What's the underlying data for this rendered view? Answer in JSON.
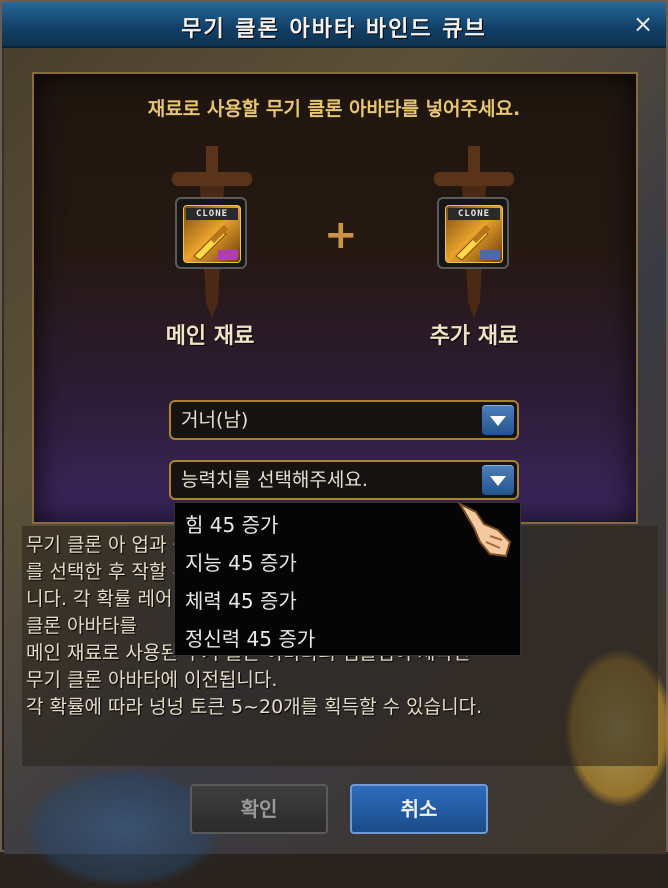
{
  "window": {
    "title": "무기 클론 아바타 바인드 큐브",
    "close_label": "×"
  },
  "instruction": "재료로 사용할 무기 클론 아바타를 넣어주세요.",
  "slots": {
    "main": {
      "caption": "메인 재료",
      "clone_tag": "CLONE"
    },
    "plus": "+",
    "extra": {
      "caption": "추가 재료",
      "clone_tag": "CLONE"
    }
  },
  "selects": {
    "job": {
      "value": "거너(남)"
    },
    "stat": {
      "value": "능력치를 선택해주세요."
    }
  },
  "dropdown": {
    "options": [
      "힘 45 증가",
      "지능 45 증가",
      "체력 45 증가",
      "정신력 45 증가"
    ]
  },
  "description": {
    "lines": [
      "무기 클론 아                                    업과 능력치",
      "를 선택한 후                                    작할 수 있습",
      "니다. 각 확률                                  레어 무기",
      "클론 아바타를",
      "메인 재료로 사용된 무기 클론 아바타의 엠블렘이 제작된",
      "무기 클론 아바타에 이전됩니다.",
      "각 확률에 따라 넝넝 토큰 5~20개를 획득할 수 있습니다."
    ]
  },
  "buttons": {
    "ok_label": "확인",
    "cancel_label": "취소"
  },
  "colors": {
    "title_bar": "#123f66",
    "accent_gold": "#a9832e",
    "cancel_blue": "#2d6cbd"
  }
}
